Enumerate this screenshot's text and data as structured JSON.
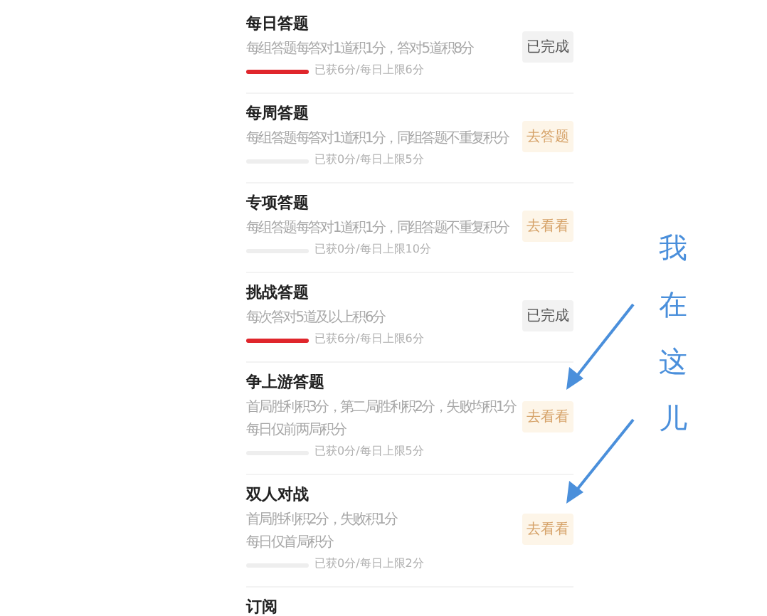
{
  "tasks": [
    {
      "title": "每日答题",
      "desc": [
        "每组答题每答对1道积1分，答对5道积8分"
      ],
      "level": 1,
      "progress": "已获6分/每日上限6分",
      "button": {
        "label": "已完成",
        "kind": "done"
      }
    },
    {
      "title": "每周答题",
      "desc": [
        "每组答题每答对1道积1分，同组答题不重复积分"
      ],
      "level": 0,
      "progress": "已获0分/每日上限5分",
      "button": {
        "label": "去答题",
        "kind": "go"
      }
    },
    {
      "title": "专项答题",
      "desc": [
        "每组答题每答对1道积1分，同组答题不重复积分"
      ],
      "level": 0,
      "progress": "已获0分/每日上限10分",
      "button": {
        "label": "去看看",
        "kind": "go"
      }
    },
    {
      "title": "挑战答题",
      "desc": [
        "每次答对5道及以上积6分"
      ],
      "level": 1,
      "progress": "已获6分/每日上限6分",
      "button": {
        "label": "已完成",
        "kind": "done"
      }
    },
    {
      "title": "争上游答题",
      "desc": [
        "首局胜利积3分，第二局胜利积2分，失败均积1分",
        "每日仅前两局积分"
      ],
      "level": 0,
      "progress": "已获0分/每日上限5分",
      "button": {
        "label": "去看看",
        "kind": "go"
      }
    },
    {
      "title": "双人对战",
      "desc": [
        "首局胜利积2分，失败积1分",
        "每日仅首局积分"
      ],
      "level": 0,
      "progress": "已获0分/每日上限2分",
      "button": {
        "label": "去看看",
        "kind": "go"
      }
    },
    {
      "title": "订阅"
    }
  ],
  "annotation": {
    "text": "我在这儿"
  }
}
